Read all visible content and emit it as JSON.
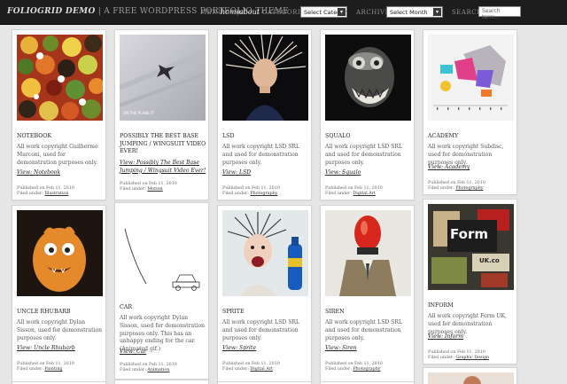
{
  "header": {
    "site_name": "FOLIOGRID DEMO",
    "tagline": "| A FREE WORDPRESS PORTFOLIO THEME",
    "menu_label": "MENU",
    "home_link": "home",
    "about_link": "about",
    "categories_label": "CATEGORIES",
    "category_select": "Select Category",
    "archives_label": "ARCHIVES",
    "month_select": "Select Month",
    "search_label": "SEARCH",
    "search_placeholder": "Search term..."
  },
  "posts": [
    {
      "title": "NOTEBOOK",
      "desc": "All work copyright Guilherme Marconi, used for demonstration purposes only.",
      "view": "View: Notebook",
      "published": "Published on Feb 11, 2010",
      "filed_label": "Filed under:",
      "category": "Illustration"
    },
    {
      "title": "POSSIBLY THE BEST BASE JUMPING / WINGSUIT VIDEO EVER!",
      "desc": "",
      "view": "View: Possibly The Best Base Jumping / Wingsuit Video Ever!",
      "published": "Published on Feb 11, 2010",
      "filed_label": "Filed under:",
      "category": "Motion",
      "thumb_text": "ON THE PLANE IT"
    },
    {
      "title": "LSD",
      "desc": "All work copyright LSD SRL and used for demonstration purposes only.",
      "view": "View: LSD",
      "published": "Published on Feb 11, 2010",
      "filed_label": "Filed under:",
      "category": "Photography"
    },
    {
      "title": "SQUALO",
      "desc": "All work copyright LSD SRL and used for demonstration purposes only.",
      "view": "View: Squalo",
      "published": "Published on Feb 11, 2010",
      "filed_label": "Filed under:",
      "category": "Digital Art"
    },
    {
      "title": "ACADEMY",
      "desc": "All work copyright Subdisc, used for demonstration purposes only.",
      "view": "View: Academy",
      "published": "Published on Feb 11, 2010",
      "filed_label": "Filed under:",
      "category": "Photography"
    },
    {
      "title": "UNCLE RHUBARB",
      "desc": "All work copyright Dylan Sisson, used for demonstration purposes only.",
      "view": "View: Uncle Rhubarb",
      "published": "Published on Feb 11, 2010",
      "filed_label": "Filed under:",
      "category": "Painting"
    },
    {
      "title": "CAR",
      "desc": "All work copyright Dylan Sisson, used for demonstration purposes only. This has an unhappy ending for the car. (Animated gif.)",
      "view": "View: Car",
      "published": "Published on Feb 11, 2010",
      "filed_label": "Filed under:",
      "category": "Animation"
    },
    {
      "title": "SPRITE",
      "desc": "All work copyright LSD SRL and used for demonstration purposes only.",
      "view": "View: Sprite",
      "published": "Published on Feb 11, 2010",
      "filed_label": "Filed under:",
      "category": "Digital Art"
    },
    {
      "title": "SIREN",
      "desc": "All work copyright LSD SRL and used for demonstration purposes only.",
      "view": "View: Siren",
      "published": "Published on Feb 11, 2010",
      "filed_label": "Filed under:",
      "category": "Photography"
    },
    {
      "title": "INFORM",
      "desc": "All work copyright Form UK, used for demonstration purposes only.",
      "view": "View: Inform",
      "published": "Published on Feb 11, 2010",
      "filed_label": "Filed under:",
      "category": "Graphic Design",
      "thumb_text": "Form",
      "thumb_text2": "UK.co"
    }
  ],
  "colors": {
    "header_bg": "#1d1d1d",
    "page_bg": "#e6e6e6",
    "card_bg": "#ffffff"
  }
}
